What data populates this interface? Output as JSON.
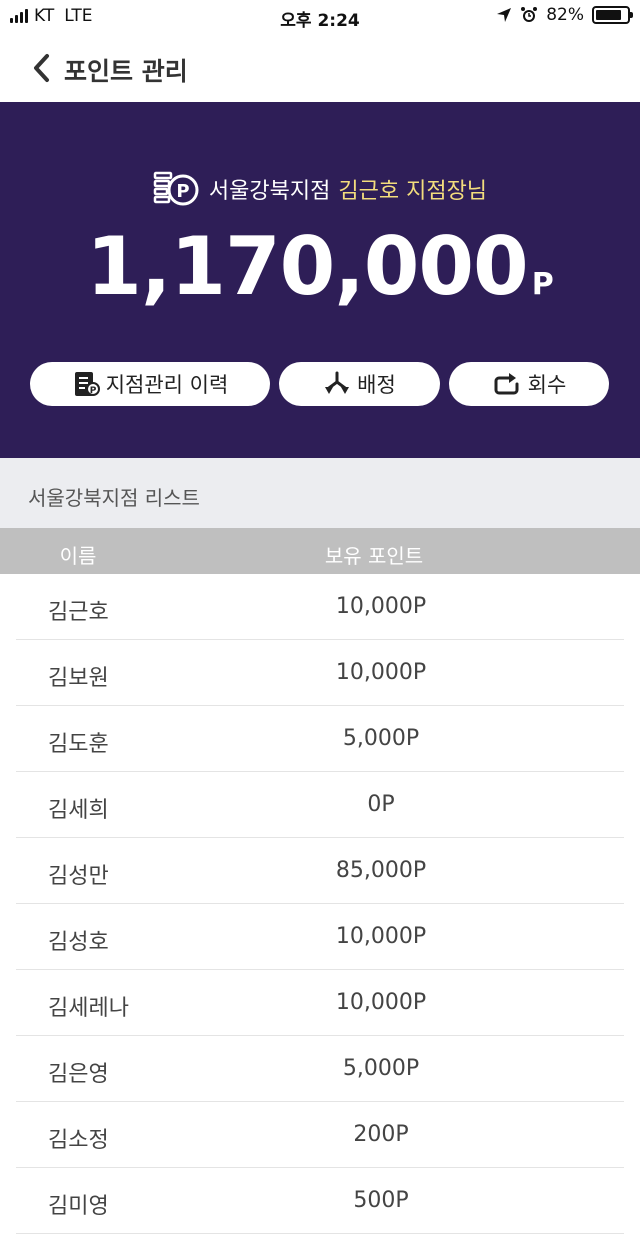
{
  "status_bar": {
    "carrier": "KT",
    "network": "LTE",
    "time": "오후 2:24",
    "battery": "82%",
    "battery_level": 0.82
  },
  "header": {
    "title": "포인트 관리"
  },
  "hero": {
    "branch": "서울강북지점",
    "manager": "김근호 지점장님",
    "points": "1,170,000",
    "unit": "P",
    "actions": [
      {
        "label": "지점관리 이력",
        "icon": "document-p-icon"
      },
      {
        "label": "배정",
        "icon": "distribute-icon"
      },
      {
        "label": "회수",
        "icon": "retrieve-icon"
      }
    ]
  },
  "list": {
    "title": "서울강북지점 리스트",
    "columns": {
      "name": "이름",
      "points": "보유 포인트"
    },
    "rows": [
      {
        "name": "김근호",
        "points": "10,000P"
      },
      {
        "name": "김보원",
        "points": "10,000P"
      },
      {
        "name": "김도훈",
        "points": "5,000P"
      },
      {
        "name": "김세희",
        "points": "0P"
      },
      {
        "name": "김성만",
        "points": "85,000P"
      },
      {
        "name": "김성호",
        "points": "10,000P"
      },
      {
        "name": "김세레나",
        "points": "10,000P"
      },
      {
        "name": "김은영",
        "points": "5,000P"
      },
      {
        "name": "김소정",
        "points": "200P"
      },
      {
        "name": "김미영",
        "points": "500P"
      }
    ]
  },
  "colors": {
    "hero_bg": "#2e1e57",
    "manager_highlight": "#f3dd7d",
    "section_bg": "#ecedf0",
    "column_header_bg": "#bfbfbf"
  }
}
